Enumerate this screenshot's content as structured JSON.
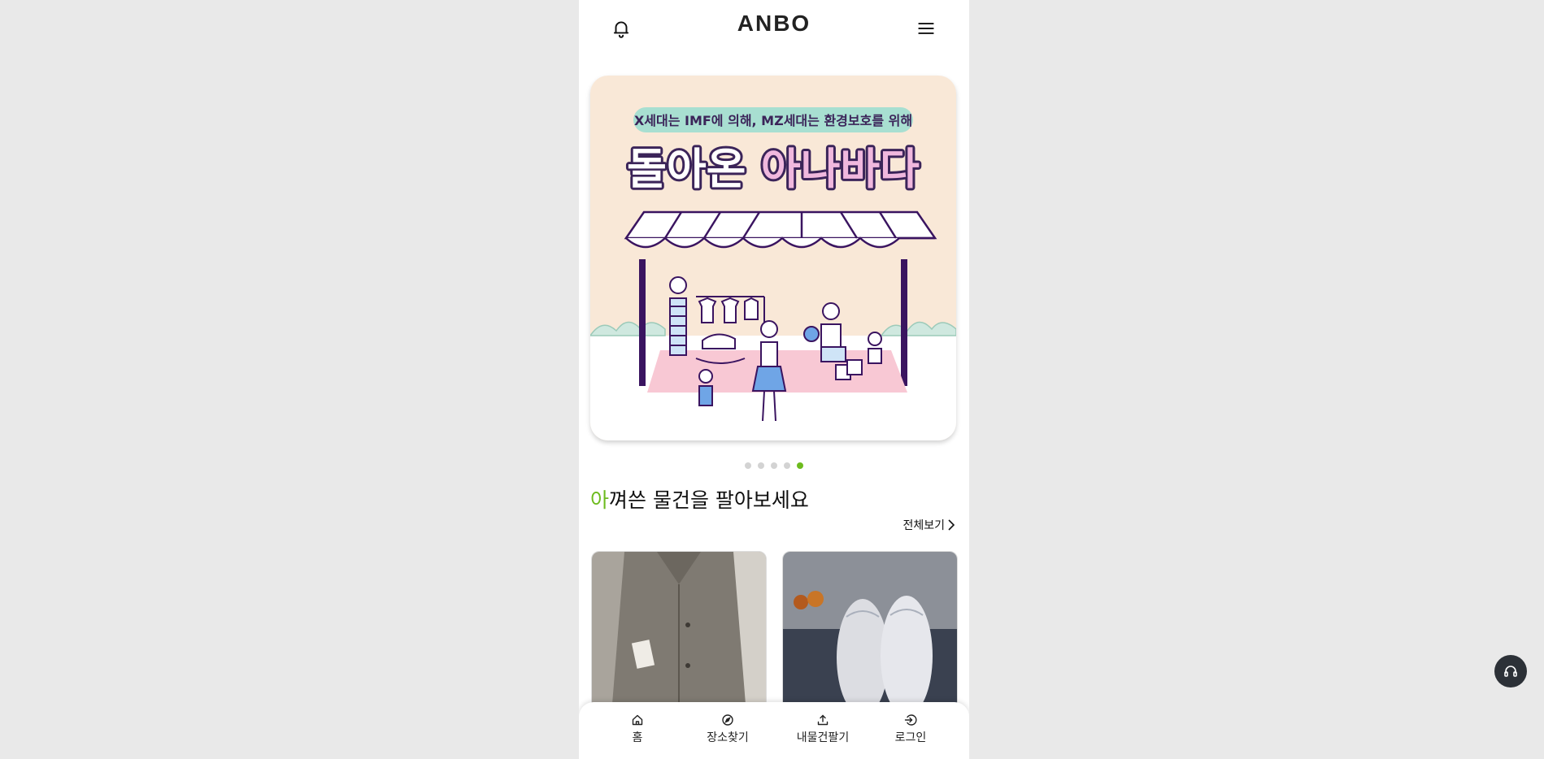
{
  "header": {
    "logo": "ANBO",
    "icons": [
      "bell-icon",
      "menu-icon"
    ]
  },
  "banner": {
    "subtitle": "X세대는 IMF에 의해, MZ세대는 환경보호를 위해",
    "headline_part1": "돌아온 ",
    "headline_part2": "아나바다",
    "colors": {
      "background": "#f9e8d7",
      "pill": "#a8dfd1",
      "headline_dark": "#3b2459",
      "headline_accent": "#f0b8de",
      "tarp_pink": "#f8c8d4",
      "pole": "#3a1460"
    }
  },
  "carousel": {
    "count": 5,
    "active_index": 4
  },
  "section": {
    "title_accent": "아",
    "title_rest": "껴쓴 물건을 팔아보세요",
    "see_all": "전체보기"
  },
  "products": [
    {
      "name": "gray-wool-coat"
    },
    {
      "name": "white-sneakers"
    }
  ],
  "bottom_nav": [
    {
      "label": "홈",
      "icon": "home-icon"
    },
    {
      "label": "장소찾기",
      "icon": "compass-icon"
    },
    {
      "label": "내물건팔기",
      "icon": "upload-icon"
    },
    {
      "label": "로그인",
      "icon": "login-icon"
    }
  ],
  "accent_color": "#6dbb1e"
}
